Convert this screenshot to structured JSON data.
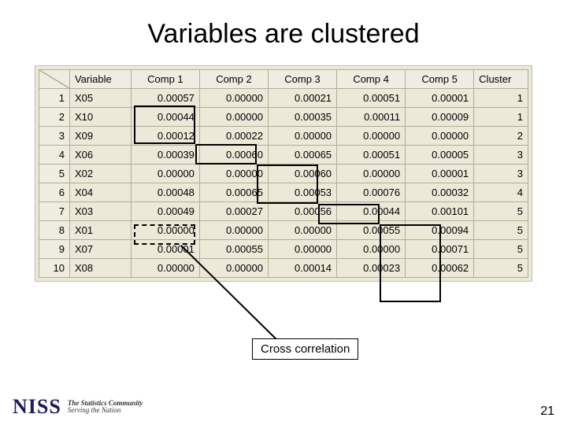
{
  "title": "Variables are clustered",
  "table": {
    "headers": [
      "",
      "Variable",
      "Comp 1",
      "Comp 2",
      "Comp 3",
      "Comp 4",
      "Comp 5",
      "Cluster"
    ],
    "rows": [
      {
        "idx": "1",
        "var": "X05",
        "c1": "0.00057",
        "c2": "0.00000",
        "c3": "0.00021",
        "c4": "0.00051",
        "c5": "0.00001",
        "cluster": "1"
      },
      {
        "idx": "2",
        "var": "X10",
        "c1": "0.00044",
        "c2": "0.00000",
        "c3": "0.00035",
        "c4": "0.00011",
        "c5": "0.00009",
        "cluster": "1"
      },
      {
        "idx": "3",
        "var": "X09",
        "c1": "0.00012",
        "c2": "0.00022",
        "c3": "0.00000",
        "c4": "0.00000",
        "c5": "0.00000",
        "cluster": "2"
      },
      {
        "idx": "4",
        "var": "X06",
        "c1": "0.00039",
        "c2": "0.00060",
        "c3": "0.00065",
        "c4": "0.00051",
        "c5": "0.00005",
        "cluster": "3"
      },
      {
        "idx": "5",
        "var": "X02",
        "c1": "0.00000",
        "c2": "0.00000",
        "c3": "0.00060",
        "c4": "0.00000",
        "c5": "0.00001",
        "cluster": "3"
      },
      {
        "idx": "6",
        "var": "X04",
        "c1": "0.00048",
        "c2": "0.00065",
        "c3": "0.00053",
        "c4": "0.00076",
        "c5": "0.00032",
        "cluster": "4"
      },
      {
        "idx": "7",
        "var": "X03",
        "c1": "0.00049",
        "c2": "0.00027",
        "c3": "0.00056",
        "c4": "0.00044",
        "c5": "0.00101",
        "cluster": "5"
      },
      {
        "idx": "8",
        "var": "X01",
        "c1": "0.00000",
        "c2": "0.00000",
        "c3": "0.00000",
        "c4": "0.00055",
        "c5": "0.00094",
        "cluster": "5"
      },
      {
        "idx": "9",
        "var": "X07",
        "c1": "0.00001",
        "c2": "0.00055",
        "c3": "0.00000",
        "c4": "0.00000",
        "c5": "0.00071",
        "cluster": "5"
      },
      {
        "idx": "10",
        "var": "X08",
        "c1": "0.00000",
        "c2": "0.00000",
        "c3": "0.00014",
        "c4": "0.00023",
        "c5": "0.00062",
        "cluster": "5"
      }
    ]
  },
  "callout": "Cross correlation",
  "footer": {
    "logo": "NISS",
    "tagline1": "The Statistics Community",
    "tagline2": "Serving the Nation",
    "page": "21"
  }
}
